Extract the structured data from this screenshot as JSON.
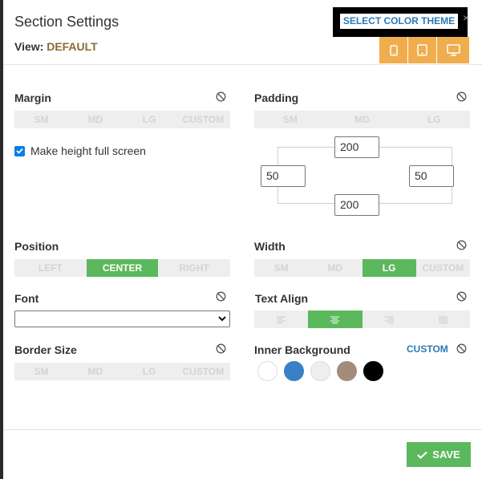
{
  "header": {
    "title": "Section Settings",
    "view_label": "View:",
    "view_value": "DEFAULT",
    "theme_button": "SELECT COLOR THEME",
    "close": "×",
    "devices": [
      "phone-icon",
      "tablet-icon",
      "desktop-icon"
    ]
  },
  "margin": {
    "label": "Margin",
    "options": [
      "SM",
      "MD",
      "LG",
      "CUSTOM"
    ]
  },
  "padding": {
    "label": "Padding",
    "options": [
      "SM",
      "MD",
      "LG"
    ],
    "top": "200",
    "left": "50",
    "right": "50",
    "bottom": "200"
  },
  "fullscreen": {
    "label": "Make height full screen",
    "checked": true
  },
  "position": {
    "label": "Position",
    "options": [
      "LEFT",
      "CENTER",
      "RIGHT"
    ],
    "selected": "CENTER"
  },
  "width": {
    "label": "Width",
    "options": [
      "SM",
      "MD",
      "LG",
      "CUSTOM"
    ],
    "selected": "LG"
  },
  "font": {
    "label": "Font",
    "value": ""
  },
  "text_align": {
    "label": "Text Align",
    "options": [
      "align-left-icon",
      "align-center-icon",
      "align-right-icon",
      "align-justify-icon"
    ],
    "selected": "align-center-icon"
  },
  "border_size": {
    "label": "Border Size",
    "options": [
      "SM",
      "MD",
      "LG",
      "CUSTOM"
    ]
  },
  "inner_background": {
    "label": "Inner Background",
    "custom": "CUSTOM",
    "swatches": [
      "#ffffff",
      "#3a80c6",
      "#eeeeee",
      "#a48c7a",
      "#000000"
    ]
  },
  "footer": {
    "save": "SAVE"
  },
  "colors": {
    "accent_orange": "#f0ad4e",
    "green": "#5cb85c",
    "blue_link": "#2a7ab5",
    "view_value": "#8b6a2e"
  }
}
